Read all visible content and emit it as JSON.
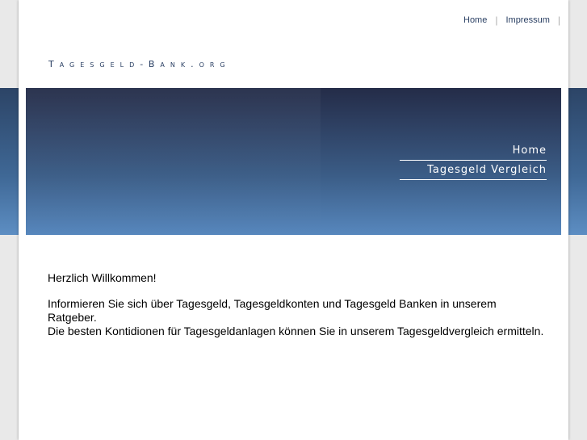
{
  "top_nav": {
    "items": [
      {
        "label": "Home"
      },
      {
        "label": "Impressum"
      }
    ],
    "separator": "|"
  },
  "site": {
    "logo_text": "Tagesgeld-Bank.org"
  },
  "banner_menu": {
    "items": [
      {
        "label": "Home"
      },
      {
        "label": "Tagesgeld Vergleich"
      }
    ]
  },
  "content": {
    "greeting": "Herzlich Willkommen!",
    "paragraph_line1": "Informieren Sie sich über Tagesgeld, Tagesgeldkonten und Tagesgeld Banken in unserem Ratgeber.",
    "paragraph_line2": "Die besten Kontidionen für Tagesgeldanlagen können Sie in unserem Tagesgeldvergleich ermitteln."
  },
  "colors": {
    "banner_top": "#242c48",
    "banner_bottom": "#5787bd",
    "link": "#2a3f63"
  }
}
